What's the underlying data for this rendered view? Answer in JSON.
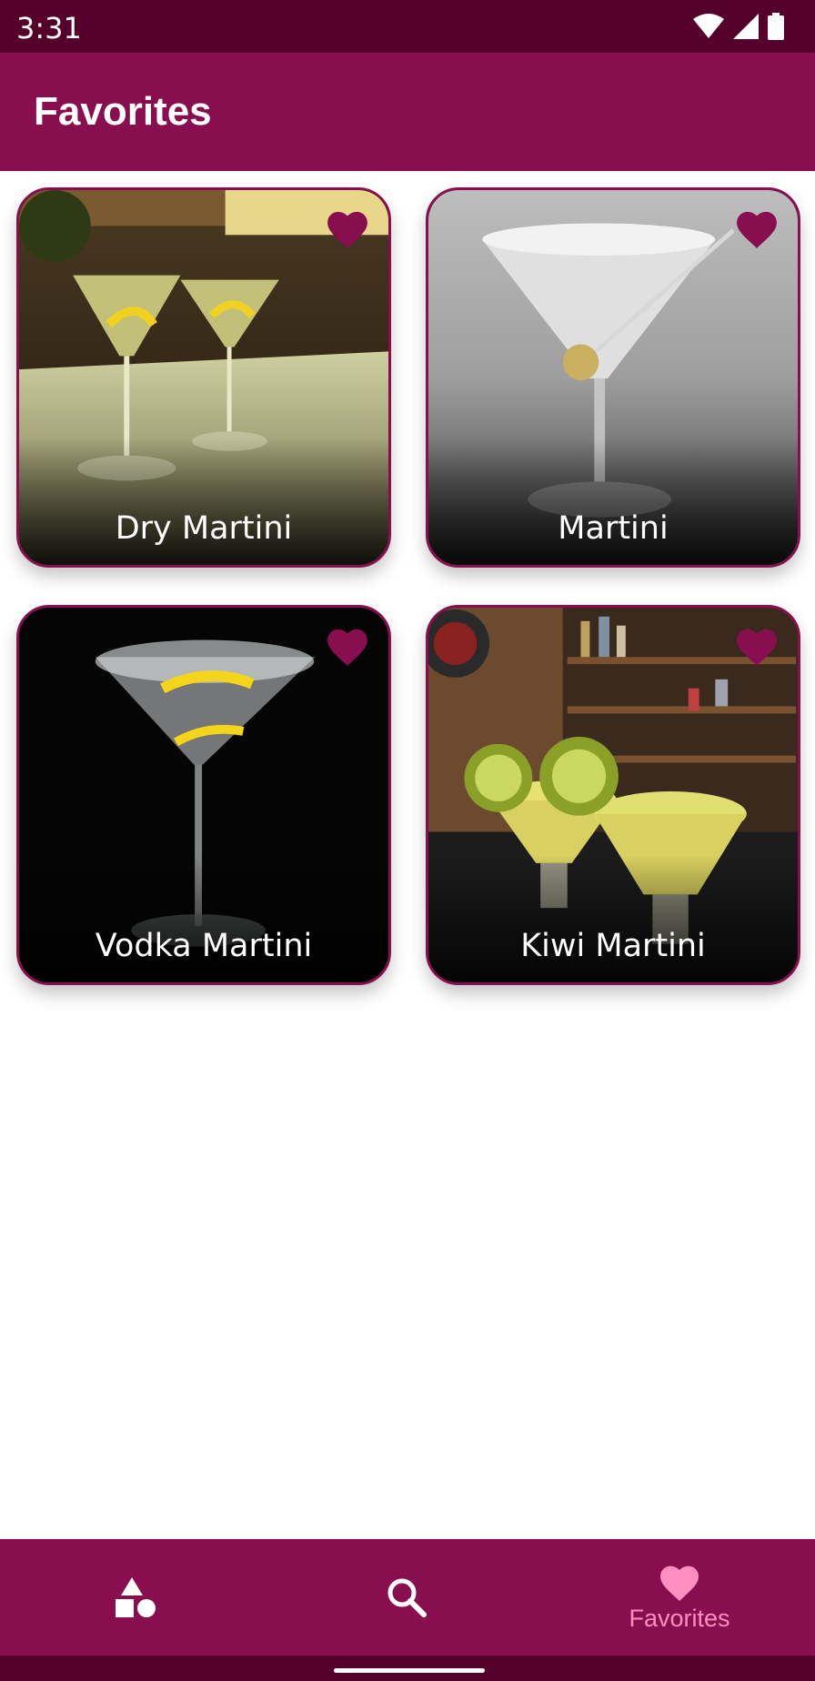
{
  "status_bar": {
    "time": "3:31",
    "icons": [
      "wifi-icon",
      "cell-signal-icon",
      "battery-icon"
    ]
  },
  "app_bar": {
    "title": "Favorites"
  },
  "colors": {
    "primary": "#880e4f",
    "primary_dark": "#55002b",
    "nav_active": "#ff8fc0",
    "text_on_primary": "#ffffff"
  },
  "cards": [
    {
      "name": "Dry Martini",
      "favorite": true
    },
    {
      "name": "Martini",
      "favorite": true
    },
    {
      "name": "Vodka Martini",
      "favorite": true
    },
    {
      "name": "Kiwi Martini",
      "favorite": true
    }
  ],
  "bottom_nav": {
    "items": [
      {
        "icon": "categories-icon",
        "label": "",
        "active": false
      },
      {
        "icon": "search-icon",
        "label": "",
        "active": false
      },
      {
        "icon": "heart-icon",
        "label": "Favorites",
        "active": true
      }
    ]
  }
}
